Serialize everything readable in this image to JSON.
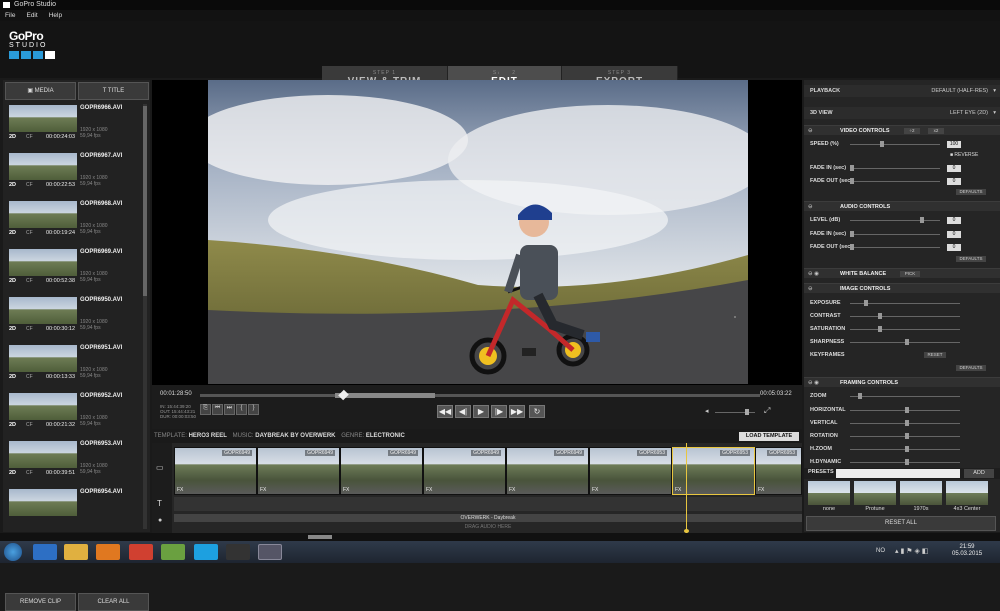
{
  "window": {
    "title": "GoPro Studio",
    "menu": [
      "File",
      "Edit",
      "Help"
    ]
  },
  "logo": {
    "line1": "GoPro",
    "line2": "STUDIO"
  },
  "steps": [
    {
      "num": "STEP 1",
      "label": "VIEW & TRIM"
    },
    {
      "num": "STEP 2",
      "label": "EDIT"
    },
    {
      "num": "STEP 3",
      "label": "EXPORT"
    }
  ],
  "left": {
    "tabs": {
      "media": "MEDIA",
      "title": "TITLE"
    },
    "clips": [
      {
        "name": "GOPR6966.AVI",
        "res": "1920 x 1080",
        "fps": "59,94 fps",
        "dur": "00:00:24:03"
      },
      {
        "name": "GOPR6967.AVI",
        "res": "1920 x 1080",
        "fps": "59,94 fps",
        "dur": "00:00:22:53"
      },
      {
        "name": "GOPR6968.AVI",
        "res": "1920 x 1080",
        "fps": "59,94 fps",
        "dur": "00:00:19:24"
      },
      {
        "name": "GOPR6969.AVI",
        "res": "1920 x 1080",
        "fps": "59,94 fps",
        "dur": "00:00:52:38"
      },
      {
        "name": "GOPR6950.AVI",
        "res": "1920 x 1080",
        "fps": "59,94 fps",
        "dur": "00:00:30:12"
      },
      {
        "name": "GOPR6951.AVI",
        "res": "1920 x 1080",
        "fps": "59,94 fps",
        "dur": "00:00:13:33"
      },
      {
        "name": "GOPR6952.AVI",
        "res": "1920 x 1080",
        "fps": "59,94 fps",
        "dur": "00:00:21:32"
      },
      {
        "name": "GOPR6953.AVI",
        "res": "1920 x 1080",
        "fps": "59,94 fps",
        "dur": "00:00:39:51"
      },
      {
        "name": "GOPR6954.AVI",
        "res": "",
        "fps": "",
        "dur": ""
      }
    ],
    "badge2d": "2D",
    "badgecf": "CF",
    "remove": "REMOVE CLIP",
    "clear": "CLEAR ALL"
  },
  "transport": {
    "current": "00:01:28:50",
    "total": "00:05:03:22",
    "in": "IN: 15:44:39:20",
    "out": "OUT: 15:44:43:21",
    "dur": "DUR: 00:00:03:50"
  },
  "template": {
    "label": "TEMPLATE:",
    "name": "HERO3 REEL",
    "music_label": "MUSIC:",
    "music": "DAYBREAK BY OVERWERK",
    "genre_label": "GENRE:",
    "genre": "ELECTRONIC",
    "load": "LOAD TEMPLATE"
  },
  "timeline": {
    "frames": [
      "GOPR6949",
      "GOPR6949",
      "GOPR6949",
      "GOPR6949",
      "GOPR6949",
      "GOPR6953",
      "GOPR6953",
      "GOPR6953"
    ],
    "audio": "OVERWERK - Daybreak",
    "drag_audio": "DRAG AUDIO HERE",
    "fx": "FX"
  },
  "right": {
    "playback": "PLAYBACK",
    "playback_val": "DEFAULT (HALF-RES)",
    "view3d": "3D VIEW",
    "view3d_val": "LEFT EYE (2D)",
    "video_controls": "VIDEO CONTROLS",
    "half": "÷2",
    "double": "x2",
    "speed": "SPEED (%)",
    "speed_val": "100",
    "reverse": "REVERSE",
    "fadein": "FADE IN (sec)",
    "fadein_val": "0",
    "fadeout": "FADE OUT (sec)",
    "fadeout_val": "0",
    "defaults": "DEFAULTS",
    "audio_controls": "AUDIO CONTROLS",
    "level": "LEVEL (dB)",
    "level_val": "0",
    "wb": "WHITE BALANCE",
    "pick": "PICK",
    "image_controls": "IMAGE CONTROLS",
    "exposure": "EXPOSURE",
    "contrast": "CONTRAST",
    "saturation": "SATURATION",
    "sharpness": "SHARPNESS",
    "keyframes": "KEYFRAMES",
    "reset": "RESET",
    "framing": "FRAMING CONTROLS",
    "zoom": "ZOOM",
    "horizontal": "HORIZONTAL",
    "vertical": "VERTICAL",
    "rotation": "ROTATION",
    "hzoom": "H.ZOOM",
    "hdynamic": "H.DYNAMIC",
    "presets": "PRESETS",
    "add": "ADD",
    "preset_names": [
      "none",
      "Protune",
      "1970s",
      "4x3 Center"
    ],
    "reset_all": "RESET ALL"
  },
  "taskbar": {
    "lang": "NO",
    "time": "21:59",
    "date": "05.03.2015"
  }
}
